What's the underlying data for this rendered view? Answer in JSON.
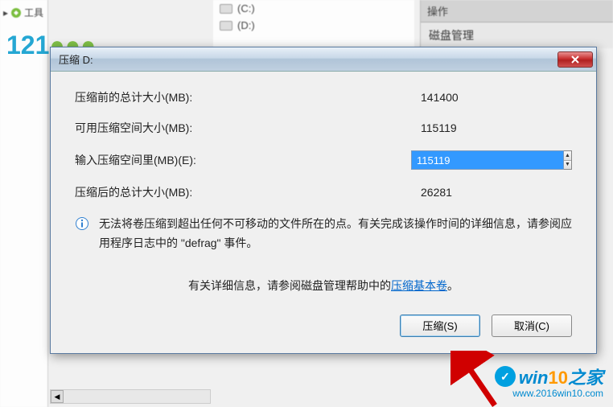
{
  "background": {
    "tree_root": "工具",
    "drive_c": "(C:)",
    "drive_d": "(D:)",
    "right_header": "操作",
    "right_title": "磁盘管理"
  },
  "dialog": {
    "title": "压缩 D:",
    "rows": {
      "before_label": "压缩前的总计大小(MB):",
      "before_value": "141400",
      "avail_label": "可用压缩空间大小(MB):",
      "avail_value": "115119",
      "input_label": "输入压缩空间里(MB)(E):",
      "input_value": "115119",
      "after_label": "压缩后的总计大小(MB):",
      "after_value": "26281"
    },
    "info_text": "无法将卷压缩到超出任何不可移动的文件所在的点。有关完成该操作时间的详细信息，请参阅应用程序日志中的 \"defrag\" 事件。",
    "help_prefix": "有关详细信息，请参阅磁盘管理帮助中的",
    "help_link": "压缩基本卷",
    "help_suffix": "。",
    "buttons": {
      "shrink": "压缩(S)",
      "cancel": "取消(C)"
    }
  },
  "watermark": {
    "num_121": "121",
    "win10_text_pre": "win",
    "win10_text_hl": "10",
    "win10_text_post": "之家",
    "win10_url": "www.2016win10.com"
  }
}
